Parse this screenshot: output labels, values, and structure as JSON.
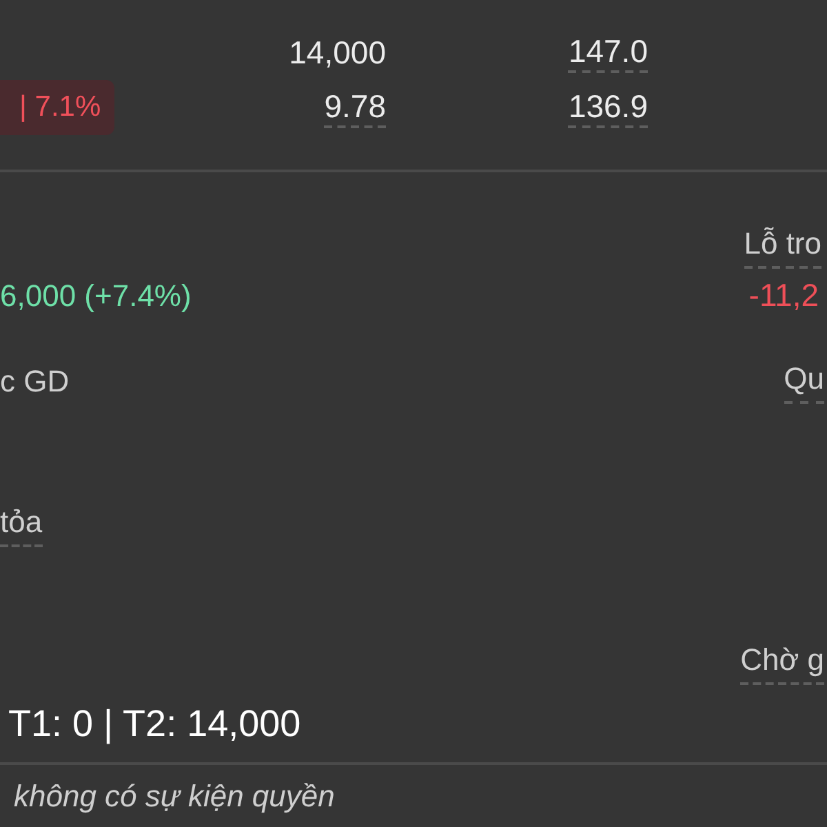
{
  "trades": [
    {
      "quantity": "14,000",
      "price": "147.0"
    },
    {
      "badge": "| 7.1%",
      "quantity": "9.78",
      "price": "136.9"
    }
  ],
  "summary": {
    "change": "6,000 (+7.4%)",
    "loss_label": "Lỗ tro",
    "loss_value": "-11,2",
    "label_1": "c GD",
    "label_2": "Qu",
    "label_3": "tỏa",
    "label_4": "Chờ g",
    "settlement": "T1: 0 | T2: 14,000"
  },
  "footer": "không có sự kiện quyền"
}
